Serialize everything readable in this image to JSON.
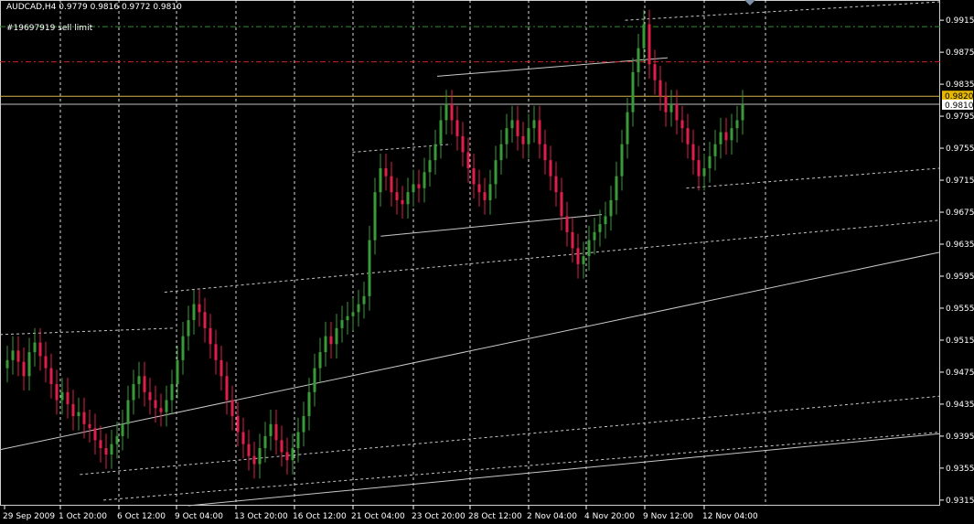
{
  "header": {
    "symbol": "AUDCAD,H4",
    "ohlc": "0.9779 0.9816 0.9772 0.9810",
    "text": "AUDCAD,H4  0.9779 0.9816 0.9772 0.9810"
  },
  "order_label": "#19697919 sell limit",
  "colors": {
    "background": "#000000",
    "bull_candle": "#3a9a3a",
    "bear_candle": "#e0204a",
    "grid": "#ffffff",
    "axis_text": "#ffffff",
    "sell_limit_line": "#2f8f2f",
    "red_dashdot_line": "#cc2222",
    "bid_line": "#d6b24a",
    "ask_line": "#c0c0c0",
    "bid_label_bg": "#e6b800",
    "channel_lines": "#c8c8c8"
  },
  "price_axis": {
    "ticks": [
      "0.9915",
      "0.9875",
      "0.9835",
      "0.9795",
      "0.9755",
      "0.9715",
      "0.9675",
      "0.9635",
      "0.9595",
      "0.9555",
      "0.9515",
      "0.9475",
      "0.9435",
      "0.9395",
      "0.9355",
      "0.9315"
    ],
    "bid_label": "0.9820",
    "current_price_label": "0.9810"
  },
  "time_axis": {
    "ticks": [
      "29 Sep 2009",
      "1 Oct 20:00",
      "6 Oct 12:00",
      "9 Oct 04:00",
      "13 Oct 20:00",
      "16 Oct 12:00",
      "21 Oct 04:00",
      "23 Oct 20:00",
      "28 Oct 12:00",
      "2 Nov 04:00",
      "4 Nov 20:00",
      "9 Nov 12:00",
      "12 Nov 04:00"
    ]
  },
  "chart_data": {
    "type": "candlestick",
    "symbol": "AUDCAD",
    "timeframe": "H4",
    "ylim": [
      0.9308,
      0.9938
    ],
    "grid": "vertical dashed",
    "levels": {
      "sell_limit": 0.9907,
      "red_dashdot": 0.9863,
      "bid": 0.982,
      "ask": 0.981
    },
    "closes": [
      0.949,
      0.9502,
      0.9488,
      0.947,
      0.95,
      0.9512,
      0.9495,
      0.948,
      0.946,
      0.944,
      0.945,
      0.9435,
      0.942,
      0.9425,
      0.941,
      0.9405,
      0.939,
      0.938,
      0.9372,
      0.9385,
      0.9395,
      0.941,
      0.944,
      0.946,
      0.947,
      0.945,
      0.944,
      0.943,
      0.9425,
      0.944,
      0.946,
      0.949,
      0.952,
      0.954,
      0.956,
      0.955,
      0.953,
      0.951,
      0.949,
      0.947,
      0.944,
      0.942,
      0.94,
      0.9385,
      0.937,
      0.936,
      0.938,
      0.9395,
      0.941,
      0.939,
      0.9375,
      0.9365,
      0.938,
      0.94,
      0.942,
      0.945,
      0.948,
      0.95,
      0.952,
      0.951,
      0.953,
      0.954,
      0.9545,
      0.955,
      0.956,
      0.957,
      0.964,
      0.97,
      0.973,
      0.972,
      0.97,
      0.969,
      0.9685,
      0.97,
      0.971,
      0.9705,
      0.9725,
      0.974,
      0.976,
      0.979,
      0.981,
      0.979,
      0.977,
      0.975,
      0.973,
      0.971,
      0.97,
      0.969,
      0.971,
      0.974,
      0.976,
      0.978,
      0.979,
      0.977,
      0.976,
      0.978,
      0.979,
      0.976,
      0.974,
      0.972,
      0.97,
      0.967,
      0.965,
      0.963,
      0.961,
      0.962,
      0.964,
      0.965,
      0.966,
      0.967,
      0.969,
      0.972,
      0.976,
      0.98,
      0.985,
      0.988,
      0.991,
      0.986,
      0.984,
      0.982,
      0.98,
      0.981,
      0.979,
      0.978,
      0.976,
      0.974,
      0.972,
      0.973,
      0.9745,
      0.976,
      0.9775,
      0.9765,
      0.978,
      0.979,
      0.981
    ],
    "channels": [
      {
        "style": "dashed",
        "x1": 0.0,
        "y1": 0.9522,
        "x2": 0.185,
        "y2": 0.953
      },
      {
        "style": "dashed",
        "x1": 0.085,
        "y1": 0.9347,
        "x2": 1.0,
        "y2": 0.9445
      },
      {
        "style": "solid",
        "x1": 0.0,
        "y1": 0.9378,
        "x2": 1.0,
        "y2": 0.9625
      },
      {
        "style": "dashed",
        "x1": 0.11,
        "y1": 0.9315,
        "x2": 1.0,
        "y2": 0.94
      },
      {
        "style": "solid",
        "x1": 0.2,
        "y1": 0.9308,
        "x2": 1.0,
        "y2": 0.9398
      },
      {
        "style": "dashed",
        "x1": 0.175,
        "y1": 0.9575,
        "x2": 1.0,
        "y2": 0.9665
      },
      {
        "style": "dashed",
        "x1": 0.375,
        "y1": 0.975,
        "x2": 0.48,
        "y2": 0.976
      },
      {
        "style": "solid",
        "x1": 0.405,
        "y1": 0.9645,
        "x2": 0.64,
        "y2": 0.9672
      },
      {
        "style": "solid",
        "x1": 0.465,
        "y1": 0.9845,
        "x2": 0.71,
        "y2": 0.9868
      },
      {
        "style": "dashed",
        "x1": 0.665,
        "y1": 0.9915,
        "x2": 1.0,
        "y2": 0.9938
      },
      {
        "style": "dashed",
        "x1": 0.73,
        "y1": 0.9705,
        "x2": 1.0,
        "y2": 0.973
      }
    ]
  }
}
